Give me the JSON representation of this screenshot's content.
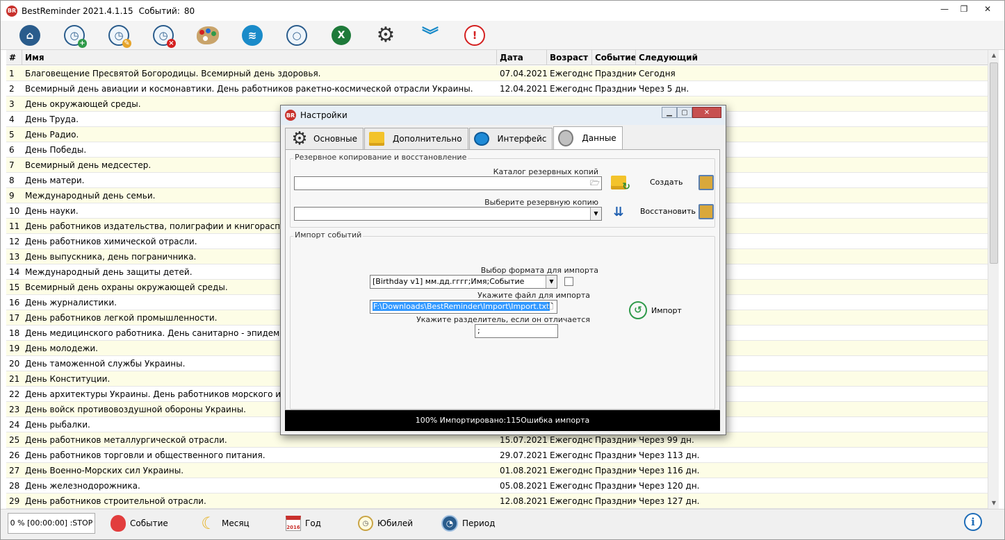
{
  "window": {
    "title": "BestReminder 2021.4.1.15",
    "events_label": "Событий:",
    "events_count": "80",
    "logo_text": "BR"
  },
  "toolbar": {
    "icons": [
      "home-icon",
      "add-event-icon",
      "edit-event-icon",
      "delete-event-icon",
      "palette-icon",
      "layers-icon",
      "search-icon",
      "excel-icon",
      "settings-gear-icon",
      "chevron-down-double-icon",
      "warning-icon"
    ]
  },
  "table": {
    "headers": {
      "num": "#",
      "name": "Имя",
      "date": "Дата",
      "age": "Возраст",
      "type": "Событие",
      "next": "Следующий"
    },
    "rows": [
      {
        "n": "1",
        "name": "Благовещение Пресвятой Богородицы. Всемирный день здоровья.",
        "date": "07.04.2021",
        "age": "Ежегодно",
        "type": "Праздник",
        "next": "Сегодня"
      },
      {
        "n": "2",
        "name": "Всемирный день авиации и космонавтики. День работников ракетно-космической отрасли Украины.",
        "date": "12.04.2021",
        "age": "Ежегодно",
        "type": "Праздник",
        "next": "Через 5 дн."
      },
      {
        "n": "3",
        "name": "День окружающей среды.",
        "date": "",
        "age": "",
        "type": "",
        "next": ""
      },
      {
        "n": "4",
        "name": "День Труда.",
        "date": "",
        "age": "",
        "type": "",
        "next": ""
      },
      {
        "n": "5",
        "name": "День Радио.",
        "date": "",
        "age": "",
        "type": "",
        "next": ""
      },
      {
        "n": "6",
        "name": "День Победы.",
        "date": "",
        "age": "",
        "type": "",
        "next": ""
      },
      {
        "n": "7",
        "name": "Всемирный день медсестер.",
        "date": "",
        "age": "",
        "type": "",
        "next": ""
      },
      {
        "n": "8",
        "name": "День матери.",
        "date": "",
        "age": "",
        "type": "",
        "next": ""
      },
      {
        "n": "9",
        "name": "Международный день семьи.",
        "date": "",
        "age": "",
        "type": "",
        "next": ""
      },
      {
        "n": "10",
        "name": "День науки.",
        "date": "",
        "age": "",
        "type": "",
        "next": ""
      },
      {
        "n": "11",
        "name": "День работников издательства, полиграфии и книгораспростр",
        "date": "",
        "age": "",
        "type": "",
        "next": ""
      },
      {
        "n": "12",
        "name": "День работников химической отрасли.",
        "date": "",
        "age": "",
        "type": "",
        "next": ""
      },
      {
        "n": "13",
        "name": "День выпускника, день пограничника.",
        "date": "",
        "age": "",
        "type": "",
        "next": ""
      },
      {
        "n": "14",
        "name": "Международный день защиты детей.",
        "date": "",
        "age": "",
        "type": "",
        "next": ""
      },
      {
        "n": "15",
        "name": "Всемирный день охраны окружающей среды.",
        "date": "",
        "age": "",
        "type": "",
        "next": ""
      },
      {
        "n": "16",
        "name": "День журналистики.",
        "date": "",
        "age": "",
        "type": "",
        "next": ""
      },
      {
        "n": "17",
        "name": "День работников легкой промышленности.",
        "date": "",
        "age": "",
        "type": "",
        "next": ""
      },
      {
        "n": "18",
        "name": "День медицинского работника. День санитарно - эпидемолог",
        "date": "",
        "age": "",
        "type": "",
        "next": ""
      },
      {
        "n": "19",
        "name": "День молодежи.",
        "date": "",
        "age": "",
        "type": "",
        "next": ""
      },
      {
        "n": "20",
        "name": "День таможенной службы Украины.",
        "date": "",
        "age": "",
        "type": "",
        "next": ""
      },
      {
        "n": "21",
        "name": "День Конституции.",
        "date": "",
        "age": "",
        "type": "",
        "next": ""
      },
      {
        "n": "22",
        "name": "День архитектуры Украины. День работников морского и реч",
        "date": "",
        "age": "",
        "type": "",
        "next": ""
      },
      {
        "n": "23",
        "name": "День войск противовоздушной обороны Украины.",
        "date": "",
        "age": "",
        "type": "",
        "next": ""
      },
      {
        "n": "24",
        "name": "День рыбалки.",
        "date": "",
        "age": "",
        "type": "",
        "next": ""
      },
      {
        "n": "25",
        "name": "День работников металлургической отрасли.",
        "date": "15.07.2021",
        "age": "Ежегодно",
        "type": "Праздник",
        "next": "Через 99 дн."
      },
      {
        "n": "26",
        "name": "День работников торговли и общественного питания.",
        "date": "29.07.2021",
        "age": "Ежегодно",
        "type": "Праздник",
        "next": "Через 113 дн."
      },
      {
        "n": "27",
        "name": "День Военно-Морских сил Украины.",
        "date": "01.08.2021",
        "age": "Ежегодно",
        "type": "Праздник",
        "next": "Через 116 дн."
      },
      {
        "n": "28",
        "name": "День железнодорожника.",
        "date": "05.08.2021",
        "age": "Ежегодно",
        "type": "Праздник",
        "next": "Через 120 дн."
      },
      {
        "n": "29",
        "name": "День работников строительной отрасли.",
        "date": "12.08.2021",
        "age": "Ежегодно",
        "type": "Праздник",
        "next": "Через 127 дн."
      }
    ]
  },
  "statusbar": {
    "progress": "0 % [00:00:00] :STOP",
    "btn_event": "Событие",
    "btn_month": "Месяц",
    "btn_year": "Год",
    "btn_year_icon_text": "2016",
    "btn_jubilee": "Юбилей",
    "btn_period": "Период",
    "info_glyph": "i"
  },
  "dialog": {
    "title": "Настройки",
    "tabs": [
      "Основные",
      "Дополнительно",
      "Интерфейс",
      "Данные"
    ],
    "active_tab": "Данные",
    "backup": {
      "group_label": "Резервное копирование и восстановление",
      "catalog_label": "Каталог резервных копий",
      "catalog_value": "",
      "choose_label": "Выберите резервную копию",
      "choose_value": "",
      "create_label": "Создать",
      "restore_label": "Восстановить"
    },
    "import": {
      "group_label": "Импорт событий",
      "format_label": "Выбор формата для импорта",
      "format_value": "[Birthday v1] мм.дд.гггг;Имя;Событие",
      "file_label": "Укажите файл для импорта",
      "file_value": "F:\\Downloads\\BestReminder\\Import\\Import.txt",
      "sep_label": "Укажите разделитель, если он отличается",
      "sep_value": ";",
      "import_label": "Импорт"
    },
    "status": "100% Импортировано:115Ошибка импорта"
  }
}
